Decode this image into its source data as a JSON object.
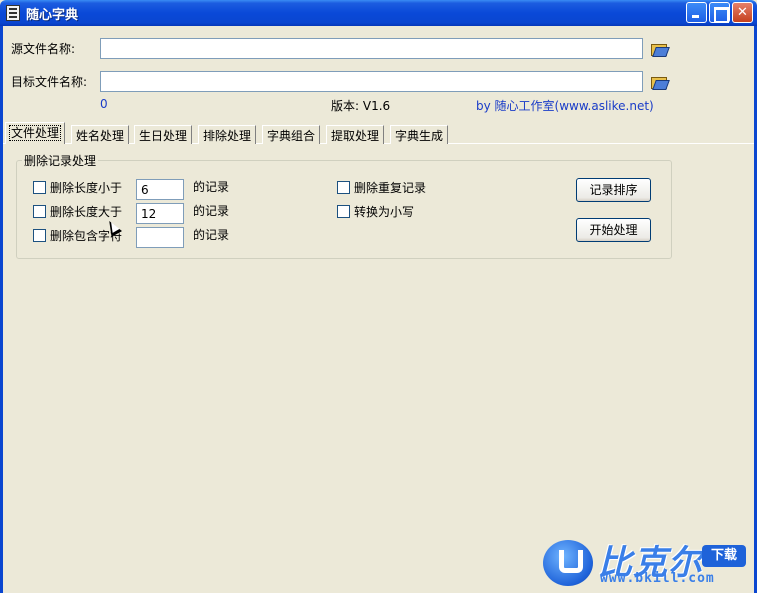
{
  "window": {
    "title": "随心字典",
    "minimize_icon": "minimize-icon",
    "maximize_icon": "maximize-icon",
    "close_icon": "close-icon",
    "close_glyph": "✕"
  },
  "files": {
    "source_label": "源文件名称:",
    "source_value": "",
    "target_label": "目标文件名称:",
    "target_value": "",
    "browse_icon": "open-folder-icon"
  },
  "info": {
    "count": "0",
    "version": "版本: V1.6",
    "credit": "by 随心工作室(www.aslike.net)",
    "credit_color": "#1A3CC8"
  },
  "tabs": [
    {
      "label": "文件处理",
      "active": true
    },
    {
      "label": "姓名处理"
    },
    {
      "label": "生日处理"
    },
    {
      "label": "排除处理"
    },
    {
      "label": "字典组合"
    },
    {
      "label": "提取处理"
    },
    {
      "label": "字典生成"
    }
  ],
  "group": {
    "title": "删除记录处理",
    "rows": [
      {
        "label": "删除长度小于",
        "value": "6",
        "suffix": "的记录",
        "checked": false
      },
      {
        "label": "删除长度大于",
        "value": "12",
        "suffix": "的记录",
        "checked": false
      },
      {
        "label": "删除包含字符",
        "value": "",
        "suffix": "的记录",
        "checked": false
      }
    ],
    "options": [
      {
        "label": "删除重复记录",
        "checked": false
      },
      {
        "label": "转换为小写",
        "checked": false
      }
    ],
    "sort_button": "记录排序",
    "start_button": "开始处理"
  },
  "watermark": {
    "brand": "比克尔",
    "badge": "下载",
    "url": "www.bkill.com"
  }
}
